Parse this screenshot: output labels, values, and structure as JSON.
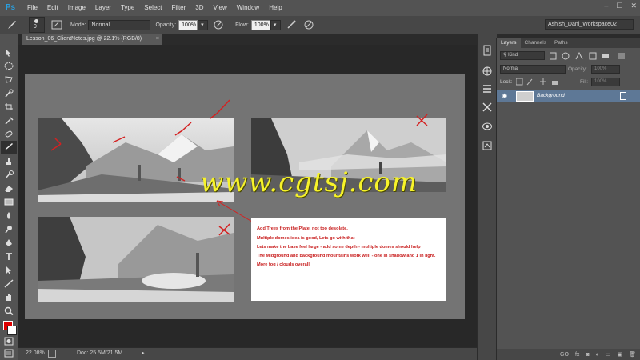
{
  "app": {
    "logo": "Ps"
  },
  "menu": [
    "File",
    "Edit",
    "Image",
    "Layer",
    "Type",
    "Select",
    "Filter",
    "3D",
    "View",
    "Window",
    "Help"
  ],
  "window_controls": [
    "–",
    "☐",
    "✕"
  ],
  "options": {
    "brush_size": "9",
    "mode_label": "Mode:",
    "mode_value": "Normal",
    "opacity_label": "Opacity:",
    "opacity_value": "100%",
    "flow_label": "Flow:",
    "flow_value": "100%",
    "workspace": "Ashish_Dani_Workspace02"
  },
  "document": {
    "tab_title": "Lesson_06_ClientNotes.jpg @ 22.1% (RGB/8)",
    "tab_close": "×",
    "watermark": "www.cgtsj.com",
    "notes": [
      "Add Trees from the Plate, not too desolate.",
      "Multiple domes idea is good, Lets go with that",
      "Lets make the base feel large - add some depth - multiple domes should help",
      "The Midground and background mountains work well - one in shadow and 1 in light.",
      "More fog / clouds overall"
    ],
    "annotation_color": "#d42121"
  },
  "status": {
    "zoom": "22.08%",
    "doc": "Doc: 25.5M/21.5M"
  },
  "layers_panel": {
    "tabs": [
      "Layers",
      "Channels",
      "Paths"
    ],
    "kind_label": "Kind",
    "blend_mode": "Normal",
    "opacity_label": "Opacity:",
    "opacity_value": "100%",
    "lock_label": "Lock:",
    "fill_label": "Fill:",
    "fill_value": "100%",
    "layer_name": "Background",
    "selected_color": "#5e7896"
  },
  "layers_footer": [
    "GO",
    "fx",
    "◙",
    "◐",
    "▭",
    "▣",
    "🗑"
  ]
}
